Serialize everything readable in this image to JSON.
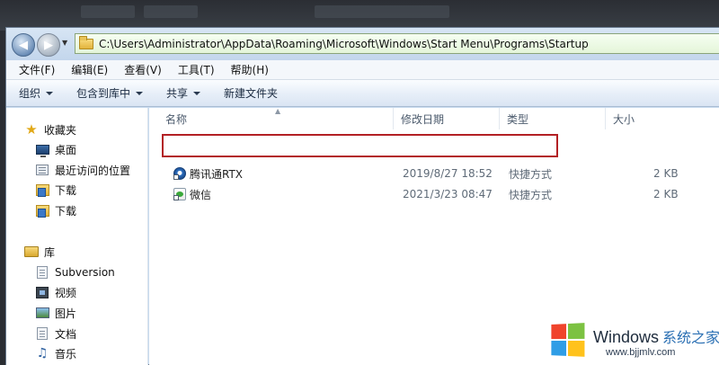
{
  "address": {
    "path": "C:\\Users\\Administrator\\AppData\\Roaming\\Microsoft\\Windows\\Start Menu\\Programs\\Startup"
  },
  "menu": [
    {
      "label": "文件(F)"
    },
    {
      "label": "编辑(E)"
    },
    {
      "label": "查看(V)"
    },
    {
      "label": "工具(T)"
    },
    {
      "label": "帮助(H)"
    }
  ],
  "toolbar": {
    "organize": "组织",
    "include_in_library": "包含到库中",
    "share": "共享",
    "new_folder": "新建文件夹"
  },
  "nav": {
    "favorites": "收藏夹",
    "desktop": "桌面",
    "recent": "最近访问的位置",
    "downloads1": "下载",
    "downloads2": "下载",
    "libraries": "库",
    "subversion": "Subversion",
    "videos": "视频",
    "pictures": "图片",
    "documents": "文档",
    "music": "音乐"
  },
  "columns": {
    "name": "名称",
    "date": "修改日期",
    "type": "类型",
    "size": "大小"
  },
  "files": [
    {
      "name": "腾讯通RTX",
      "date": "2019/8/27 18:52",
      "type": "快捷方式",
      "size": "2 KB"
    },
    {
      "name": "微信",
      "date": "2021/3/23 08:47",
      "type": "快捷方式",
      "size": "2 KB"
    }
  ],
  "watermark": {
    "title": "Windows",
    "title_cn": "系统之家",
    "url": "www.bjjmlv.com"
  },
  "colors": {
    "highlight": "#b32024",
    "address_bg": "#e4f5d9"
  }
}
